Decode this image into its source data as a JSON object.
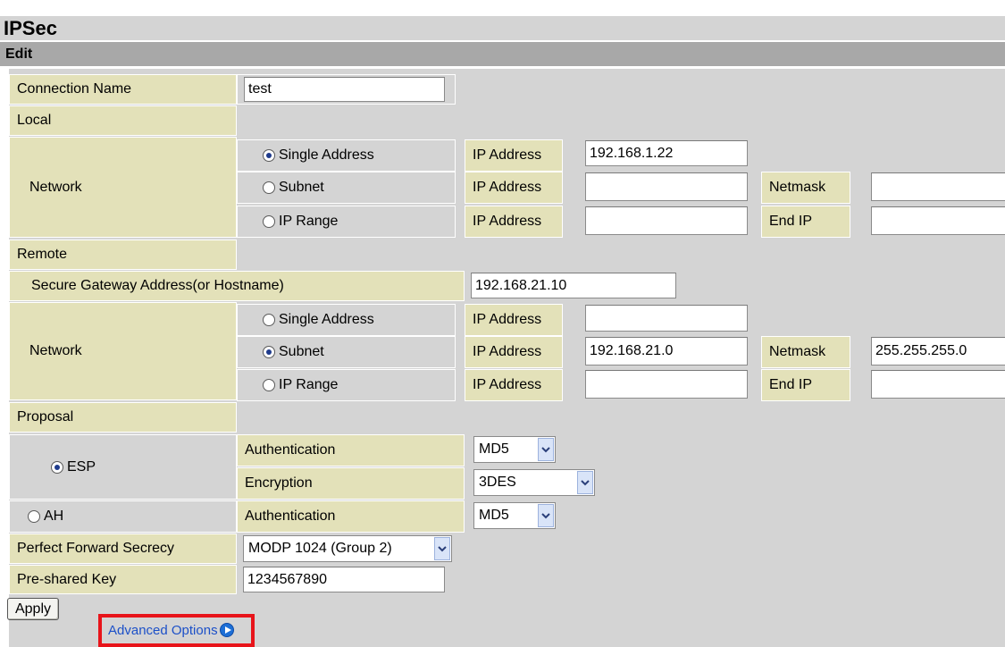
{
  "title": "IPSec",
  "section": "Edit",
  "connection": {
    "label": "Connection Name",
    "value": "test"
  },
  "local": {
    "label": "Local",
    "network_label": "Network",
    "options": [
      {
        "label": "Single Address",
        "selected": true,
        "ip_label": "IP Address",
        "ip_value": "192.168.1.22"
      },
      {
        "label": "Subnet",
        "selected": false,
        "ip_label": "IP Address",
        "ip_value": "",
        "extra_label": "Netmask",
        "extra_value": ""
      },
      {
        "label": "IP Range",
        "selected": false,
        "ip_label": "IP Address",
        "ip_value": "",
        "extra_label": "End IP",
        "extra_value": ""
      }
    ]
  },
  "remote": {
    "label": "Remote",
    "gateway_label": "Secure Gateway Address(or Hostname)",
    "gateway_value": "192.168.21.10",
    "network_label": "Network",
    "options": [
      {
        "label": "Single Address",
        "selected": false,
        "ip_label": "IP Address",
        "ip_value": ""
      },
      {
        "label": "Subnet",
        "selected": true,
        "ip_label": "IP Address",
        "ip_value": "192.168.21.0",
        "extra_label": "Netmask",
        "extra_value": "255.255.255.0"
      },
      {
        "label": "IP Range",
        "selected": false,
        "ip_label": "IP Address",
        "ip_value": "",
        "extra_label": "End IP",
        "extra_value": ""
      }
    ]
  },
  "proposal": {
    "label": "Proposal",
    "esp": {
      "label": "ESP",
      "selected": true,
      "auth_label": "Authentication",
      "auth_value": "MD5",
      "enc_label": "Encryption",
      "enc_value": "3DES"
    },
    "ah": {
      "label": "AH",
      "selected": false,
      "auth_label": "Authentication",
      "auth_value": "MD5"
    }
  },
  "pfs": {
    "label": "Perfect Forward Secrecy",
    "value": "MODP 1024 (Group 2)"
  },
  "psk": {
    "label": "Pre-shared Key",
    "value": "1234567890"
  },
  "actions": {
    "apply": "Apply",
    "advanced": "Advanced Options"
  },
  "icons": {
    "dropdown": "chevron-down-icon",
    "advanced": "play-circle-icon"
  },
  "colors": {
    "label_bg": "#e3e1b9",
    "panel_bg": "#d4d4d4",
    "header_bg": "#a8a8a8",
    "highlight": "#e8141a",
    "link": "#1c50c8"
  }
}
